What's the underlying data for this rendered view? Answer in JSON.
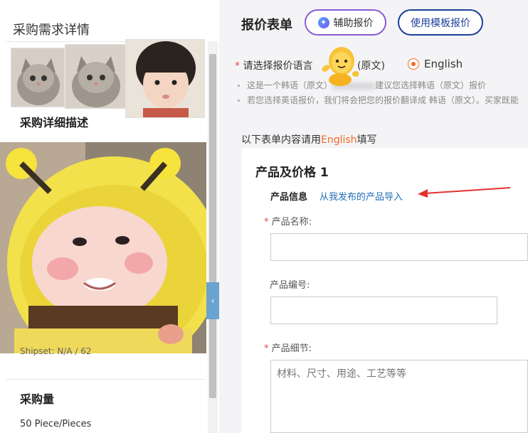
{
  "left": {
    "title": "采购需求详情",
    "detail_heading": "采购详细描述",
    "spec_fragment": "Shipset: N/A / 62",
    "quantity_heading": "采购量",
    "quantity_value": "50 Piece/Pieces"
  },
  "quote": {
    "title": "报价表单",
    "assist_button": "辅助报价",
    "template_button": "使用模板报价",
    "lang_prompt": "请选择报价语言",
    "lang_original_option": "(原文)",
    "lang_english_option": "English",
    "note1_start": "这是一个韩语（原文）",
    "note1_end": "建议您选择韩语（原文）报价",
    "note2": "若您选择英语报价，我们将会把您的报价翻译成 韩语（原文）。买家既能",
    "fill_hint_prefix": "以下表单内容请用",
    "fill_hint_lang": "English",
    "fill_hint_suffix": "填写"
  },
  "form": {
    "section_title": "产品及价格 1",
    "product_info_label": "产品信息",
    "import_link": "从我发布的产品导入",
    "name_label": "产品名称:",
    "code_label": "产品编号:",
    "detail_label": "产品细节:",
    "detail_placeholder": "材料、尺寸、用途、工艺等等"
  },
  "colors": {
    "accent_orange": "#f06a28",
    "link_blue": "#1f6fb5",
    "template_border": "#1c3f9a",
    "assist_border": "#8a5ad6",
    "required_red": "#e54646"
  }
}
